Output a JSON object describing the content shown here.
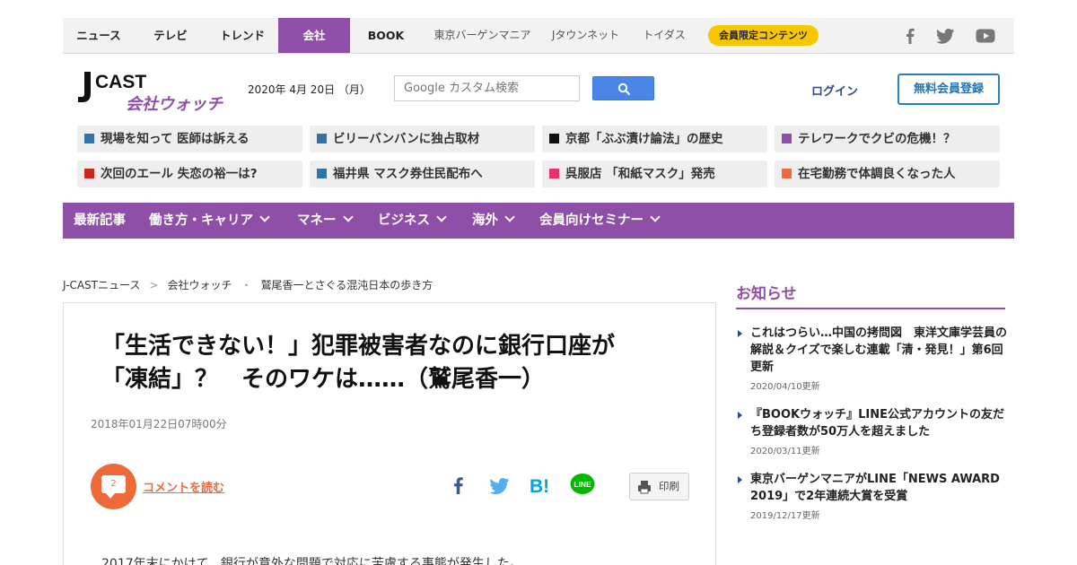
{
  "top_nav": {
    "items": [
      "ニュース",
      "テレビ",
      "トレンド",
      "会社",
      "BOOK",
      "東京バーゲンマニア",
      "Jタウンネット",
      "トイダス"
    ],
    "member_badge": "会員限定コンテンツ"
  },
  "social_icons": [
    "facebook-icon",
    "twitter-icon",
    "youtube-icon"
  ],
  "logo": {
    "line1": "J-CAST",
    "line2": "会社ウォッチ"
  },
  "header": {
    "date": "2020年 4月 20日 （月）",
    "search_placeholder": "Google カスタム検索",
    "login": "ログイン",
    "register": "無料会員登録"
  },
  "topics": [
    {
      "label": "現場を知って 医師は訴える",
      "color": "#2e74a8"
    },
    {
      "label": "ビリーバンバンに独占取材",
      "color": "#2e74a8"
    },
    {
      "label": "京都「ぶぶ漬け論法」の歴史",
      "color": "#111111"
    },
    {
      "label": "テレワークでクビの危機！？",
      "color": "#8f4fa8"
    },
    {
      "label": "次回のエール 失恋の裕一は?",
      "color": "#c8281e"
    },
    {
      "label": "福井県 マスク券住民配布へ",
      "color": "#2e74a8"
    },
    {
      "label": "呉服店 「和紙マスク」発売",
      "color": "#e8326e"
    },
    {
      "label": "在宅勤務で体調良くなった人",
      "color": "#ee6a3a"
    }
  ],
  "categories": [
    "最新記事",
    "働き方・キャリア",
    "マネー",
    "ビジネス",
    "海外",
    "会員向けセミナー"
  ],
  "breadcrumb": [
    "J-CASTニュース",
    "会社ウォッチ",
    "鷲尾香一とさぐる混沌日本の歩き方"
  ],
  "article": {
    "title_line1": "「生活できない！」犯罪被害者なのに銀行口座が",
    "title_line2": "「凍結」？　そのワケは……（鷲尾香一）",
    "published": "2018年01月22日07時00分",
    "comment_count": "2",
    "comment_link": "コメントを読む",
    "print_label": "印刷",
    "body_first_line": "2017年末にかけて、銀行が意外な問題で対応に苦慮する事態が発生した。"
  },
  "share_icons": [
    "facebook-share-icon",
    "twitter-share-icon",
    "hatena-bookmark-icon",
    "line-share-icon"
  ],
  "hatena_label": "B!",
  "line_label": "LINE",
  "sidebar": {
    "title": "お知らせ",
    "news": [
      {
        "text": "これはつらい…中国の拷問図　東洋文庫学芸員の解説＆クイズで楽しむ連載「清・発見！」第6回更新",
        "date": "2020/04/10更新"
      },
      {
        "text": "『BOOKウォッチ』LINE公式アカウントの友だち登録者数が50万人を超えました",
        "date": "2020/03/11更新"
      },
      {
        "text": "東京バーゲンマニアがLINE「NEWS AWARD 2019」で2年連続大賞を受賞",
        "date": "2019/12/17更新"
      }
    ]
  },
  "colors": {
    "brand_purple": "#8f4fa8",
    "accent_orange": "#ee6a3a",
    "member_yellow": "#f7c800",
    "link_blue": "#2c4a8c",
    "search_blue": "#4a86e8"
  }
}
